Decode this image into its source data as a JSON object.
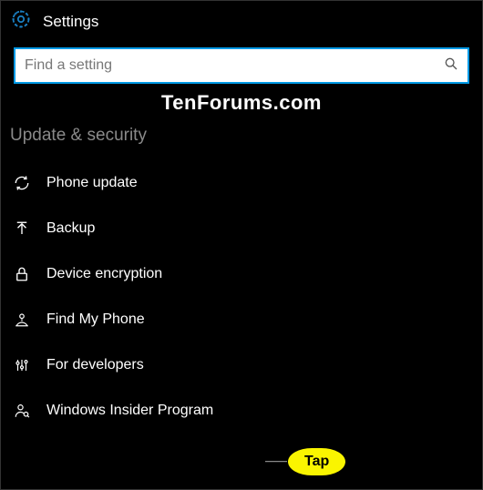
{
  "header": {
    "title": "Settings"
  },
  "search": {
    "placeholder": "Find a setting"
  },
  "watermark": "TenForums.com",
  "section": {
    "title": "Update & security"
  },
  "menu": {
    "items": [
      {
        "icon": "refresh-icon",
        "label": "Phone update"
      },
      {
        "icon": "arrow-up-icon",
        "label": "Backup"
      },
      {
        "icon": "lock-icon",
        "label": "Device encryption"
      },
      {
        "icon": "find-phone-icon",
        "label": "Find My Phone"
      },
      {
        "icon": "developer-icon",
        "label": "For developers"
      },
      {
        "icon": "insider-icon",
        "label": "Windows Insider Program"
      }
    ]
  },
  "callout": {
    "label": "Tap"
  }
}
